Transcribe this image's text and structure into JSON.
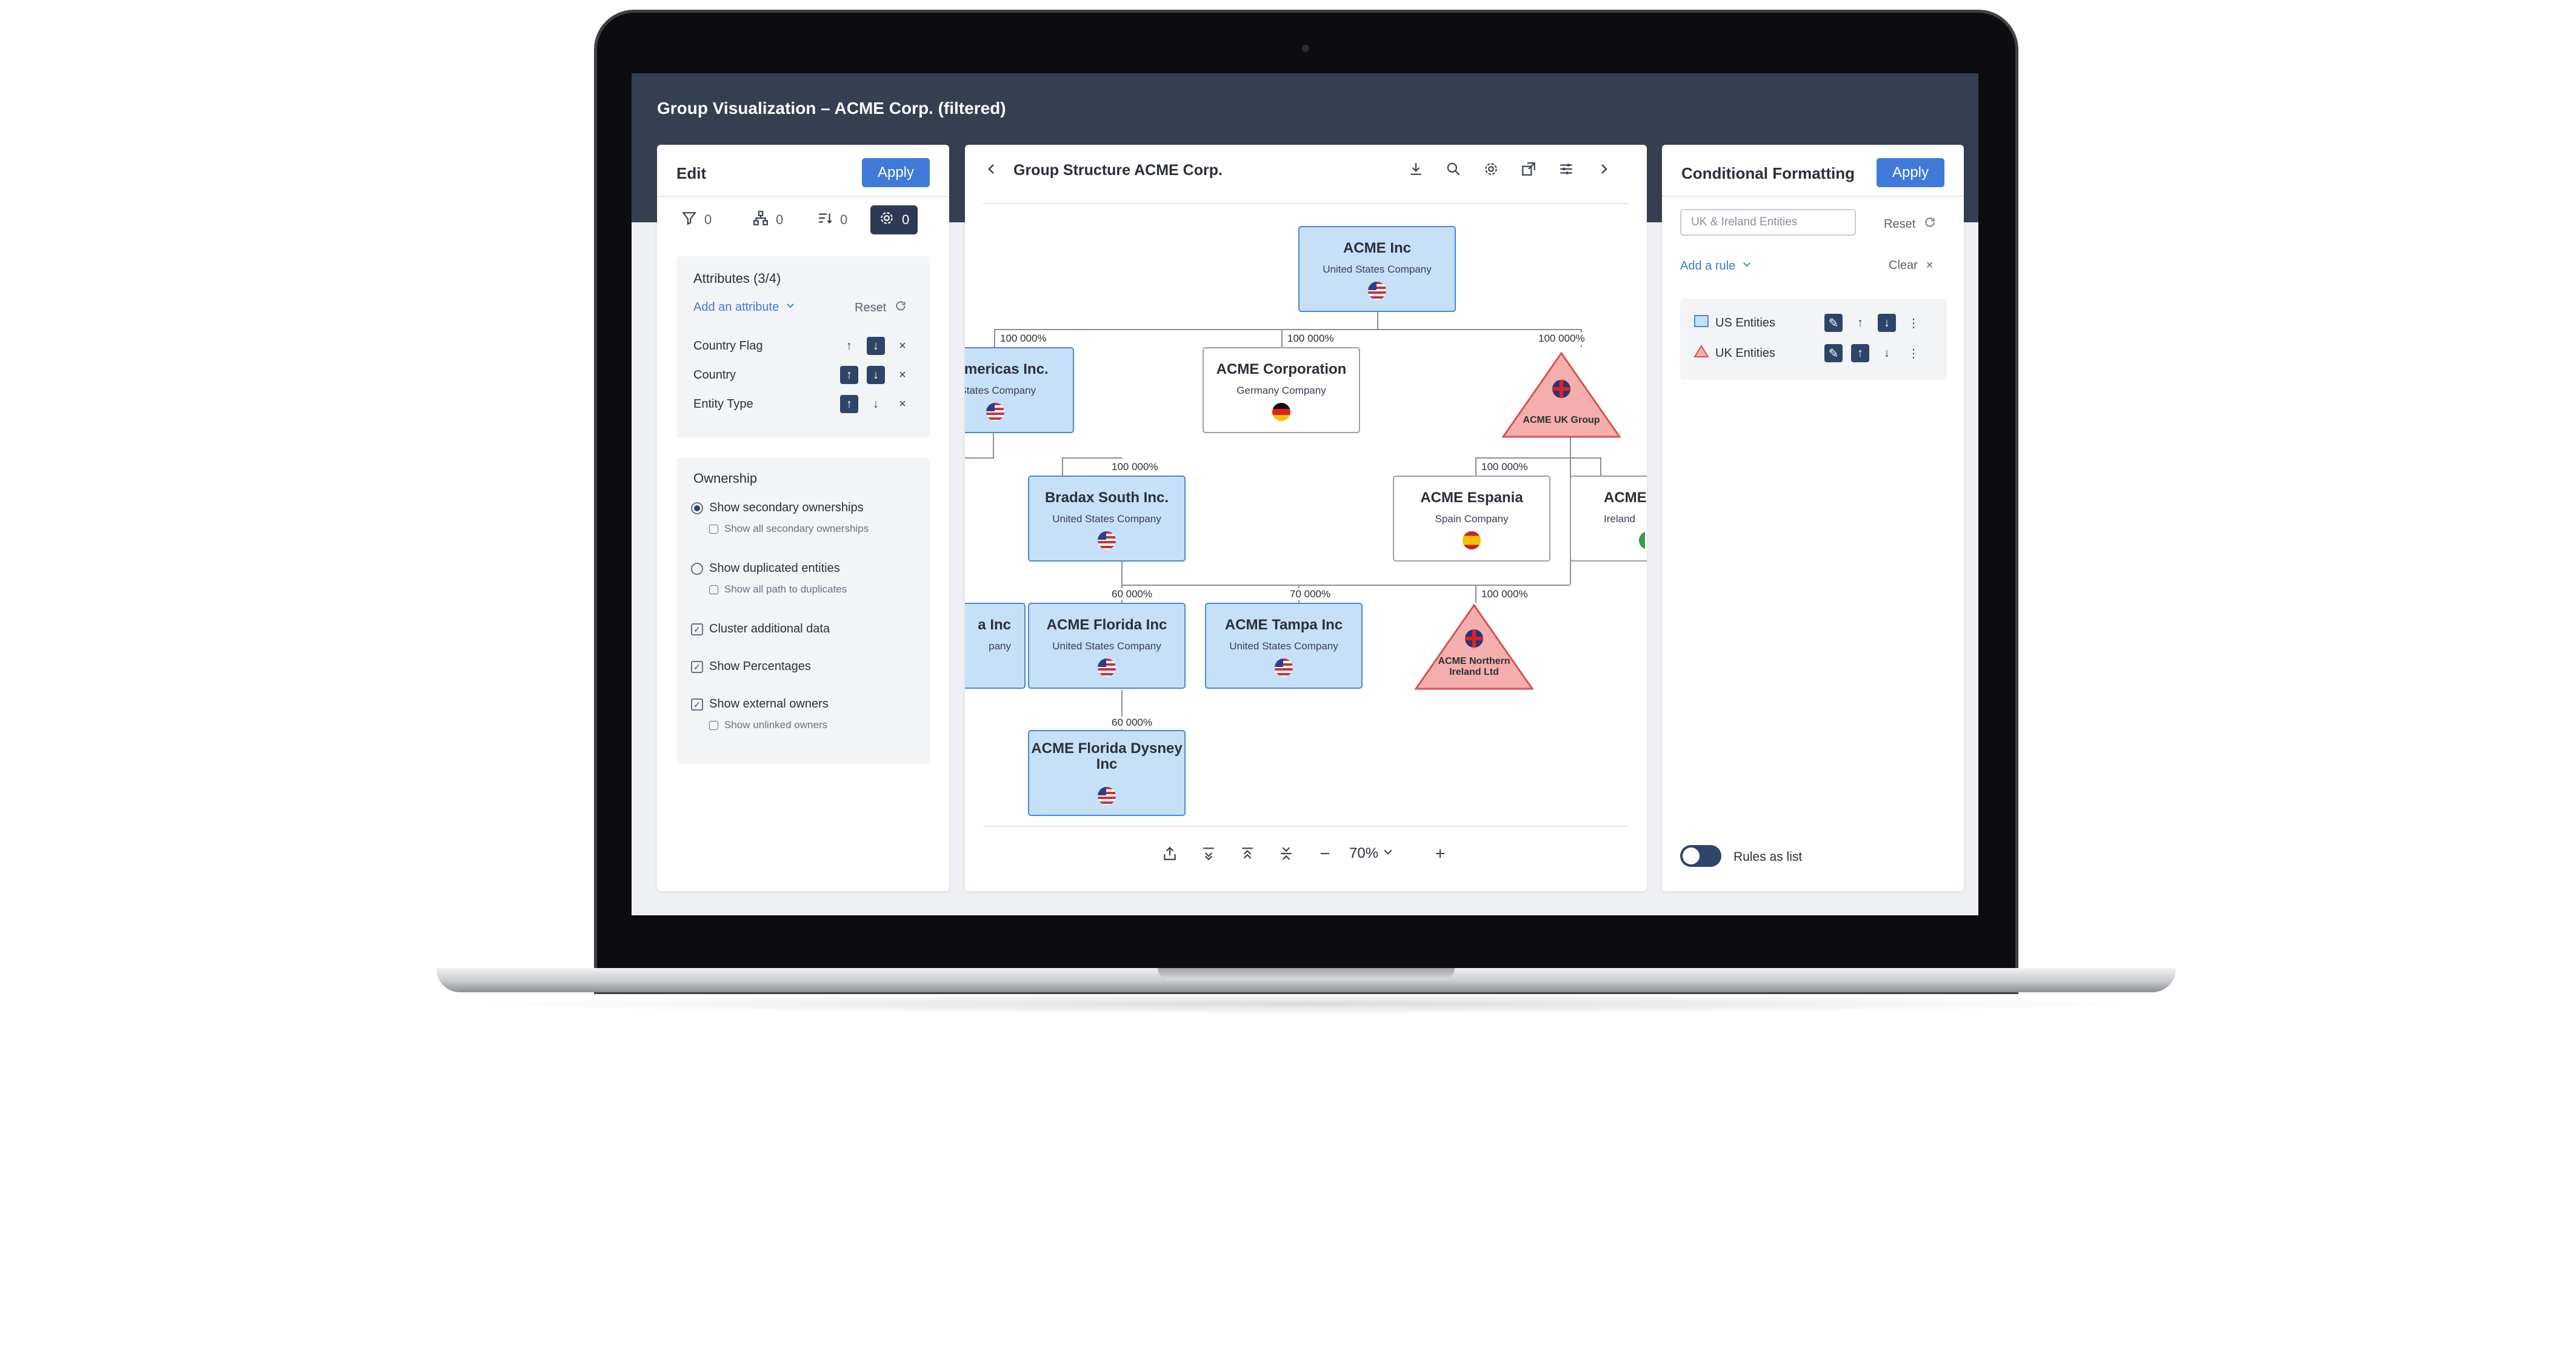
{
  "window": {
    "title": "Group Visualization – ACME Corp. (filtered)"
  },
  "edit_panel": {
    "title": "Edit",
    "apply_label": "Apply",
    "toolbar": {
      "filter_count": "0",
      "hierarchy_count": "0",
      "sort_count": "0",
      "settings_count": "0"
    },
    "attributes": {
      "title": "Attributes (3/4)",
      "add_label": "Add an attribute",
      "reset_label": "Reset",
      "items": [
        {
          "label": "Country Flag"
        },
        {
          "label": "Country"
        },
        {
          "label": "Entity Type"
        }
      ]
    },
    "ownership": {
      "title": "Ownership",
      "options": {
        "secondary": "Show secondary ownerships",
        "all_secondary": "Show all secondary ownerships",
        "duplicated": "Show duplicated entities",
        "all_path": "Show all path to duplicates",
        "cluster": "Cluster additional data",
        "percentages": "Show Percentages",
        "external": "Show external owners",
        "unlinked": "Show unlinked owners"
      }
    }
  },
  "chart": {
    "title": "Group Structure ACME Corp.",
    "zoom": "70%",
    "nodes": {
      "acme_inc": {
        "name": "ACME Inc",
        "type": "United States Company"
      },
      "americas": {
        "name": "x Americas Inc.",
        "type": "l States Company"
      },
      "corporation": {
        "name": "ACME Corporation",
        "type": "Germany Company"
      },
      "uk_group": {
        "name": "ACME UK Group"
      },
      "bradax": {
        "name": "Bradax South Inc.",
        "type": "United States Company"
      },
      "espania": {
        "name": "ACME Espania",
        "type": "Spain Company"
      },
      "ireland": {
        "name": "ACME",
        "type": "Ireland"
      },
      "partial": {
        "name": "a Inc",
        "type": "pany"
      },
      "florida": {
        "name": "ACME Florida Inc",
        "type": "United States Company"
      },
      "tampa": {
        "name": "ACME Tampa Inc",
        "type": "United States Company"
      },
      "northern": {
        "name": "ACME Northern Ireland Ltd"
      },
      "dysney": {
        "name": "ACME Florida Dysney Inc"
      }
    },
    "percentages": {
      "p1": "100 000%",
      "p2": "100 000%",
      "p3": "100 000%",
      "p4": "100 000%",
      "p5": "100 000%",
      "p6": "60 000%",
      "p7": "70 000%",
      "p8": "100 000%",
      "p9": "60 000%"
    }
  },
  "cf_panel": {
    "title": "Conditional Formatting",
    "apply_label": "Apply",
    "search_placeholder": "UK & Ireland Entities",
    "reset_label": "Reset",
    "add_rule_label": "Add a rule",
    "clear_label": "Clear",
    "rules": [
      {
        "label": "US Entities"
      },
      {
        "label": "UK Entities"
      }
    ],
    "rules_as_list_label": "Rules as list"
  },
  "colors": {
    "accent": "#3f7ad8",
    "header": "#363f52",
    "us_fill": "#c6e0f8",
    "uk_fill": "#f4aeae"
  }
}
